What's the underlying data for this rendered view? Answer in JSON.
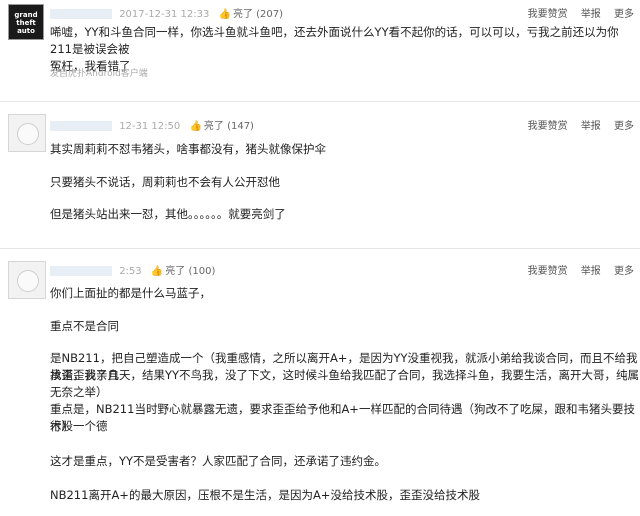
{
  "actions": {
    "report_label": "举报",
    "more_label": "更多",
    "tip_label": "我要赞赏"
  },
  "posts": [
    {
      "time": "2017-12-31 12:33",
      "likes": "亮了 (207)",
      "avatar_text": "grand theft auto",
      "lines": [
        "唏嘘，YY和斗鱼合同一样，你选斗鱼就斗鱼吧，还去外面说什么YY看不起你的话，可以可以，亏我之前还以为你211是被误会被",
        "冤枉，我看错了"
      ],
      "source": "发自虎扑Android客户端"
    },
    {
      "time": "12-31 12:50",
      "likes": "亮了 (147)",
      "paragraphs": [
        "其实周莉莉不怼韦猪头，啥事都没有，猪头就像保护伞",
        "只要猪头不说话，周莉莉也不会有人公开怼他",
        "但是猪头站出来一怼，其他。。。。。。就要亮剑了"
      ]
    },
    {
      "time": "2:53",
      "likes": "亮了 (100)",
      "paragraphs": [
        "你们上面扯的都是什么马蓝子，",
        "重点不是合同",
        "是NB211，把自己塑造成一个（我重感情，之所以离开A+，是因为YY没重视我，就派小弟给我谈合同，而且不给我承诺，我亲自",
        "找歪歪谈了几天，结果YY不鸟我，没了下文，这时候斗鱼给我匹配了合同，我选择斗鱼，我要生活，离开大哥，纯属无奈之举）",
        "重点是，NB211当时野心就暴露无遗，要求歪歪给予他和A+一样匹配的合同待遇（狗改不了吃屎，跟和韦猪头要技术股一个德",
        "行）",
        "这才是重点，YY不是受害者？人家匹配了合同，还承诺了违约金。",
        "NB211离开A+的最大原因，压根不是生活，是因为A+没给技术股，歪歪没给技术股"
      ]
    }
  ]
}
